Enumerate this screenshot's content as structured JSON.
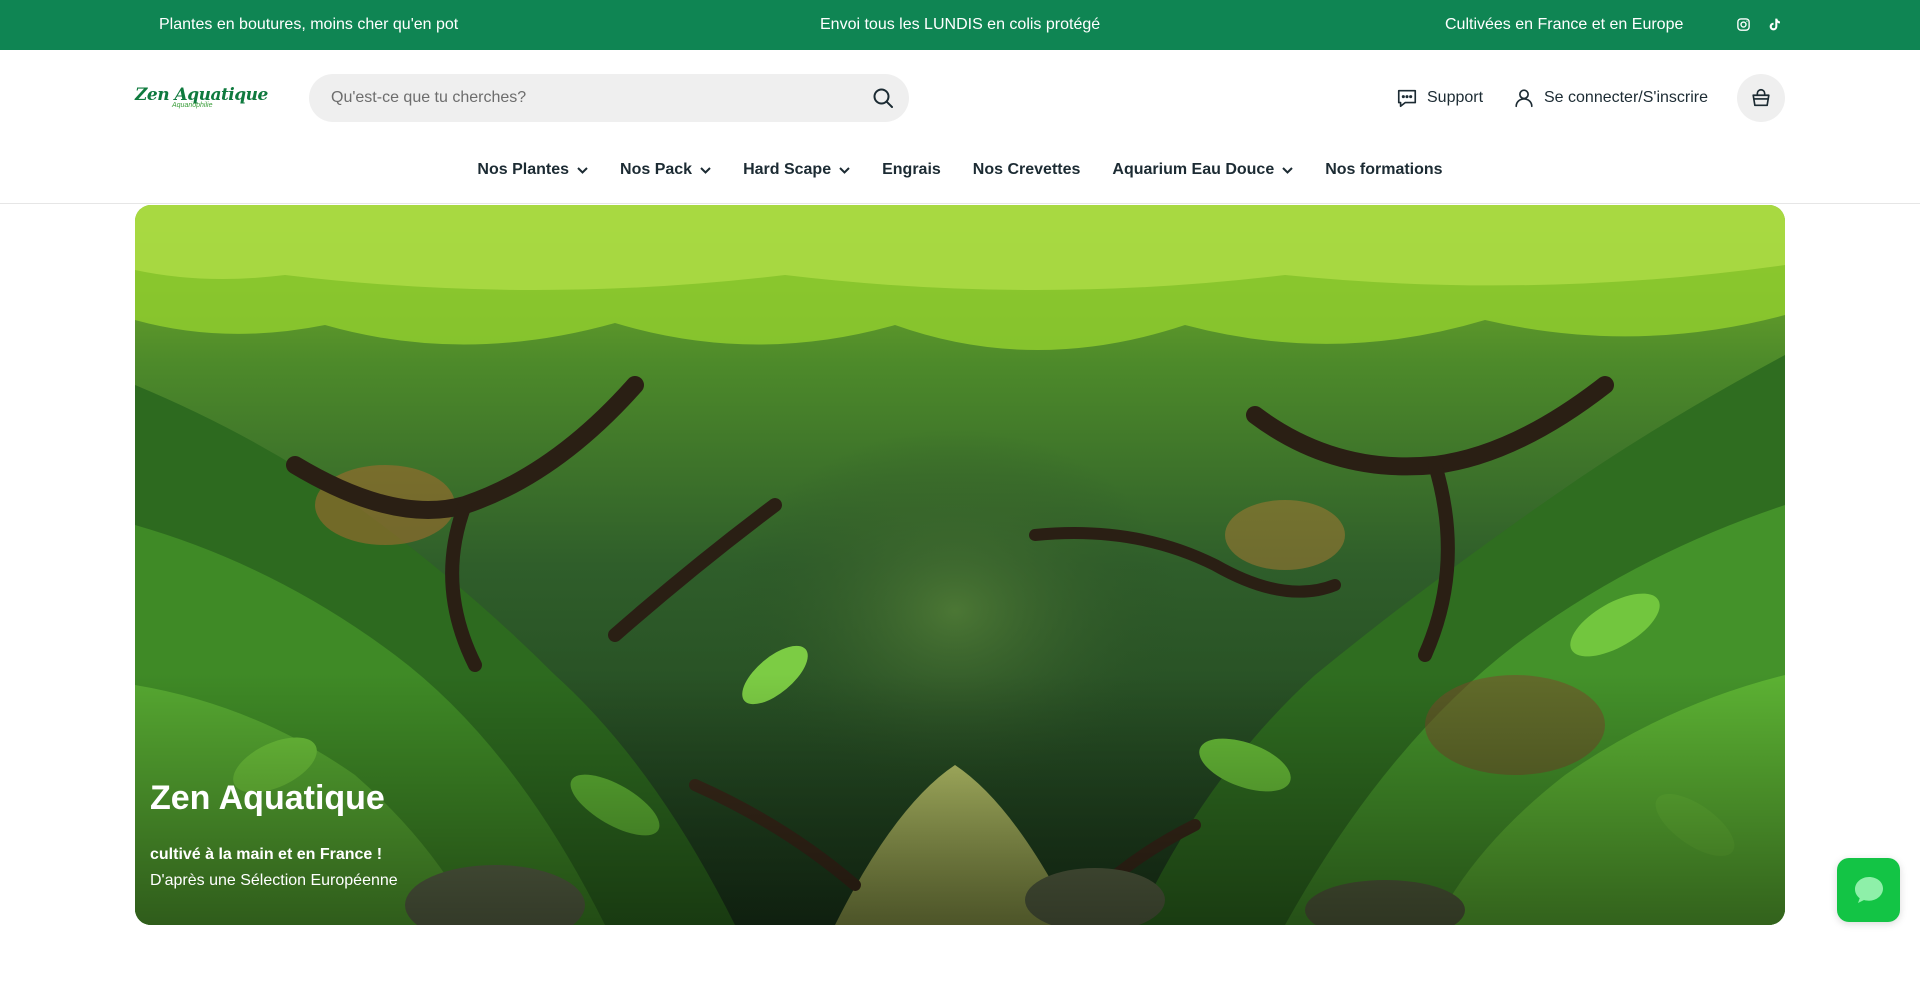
{
  "announcement": {
    "messages": [
      "Plantes en boutures, moins cher qu'en pot",
      "Envoi tous les LUNDIS en colis protégé",
      "Cultivées en France et en Europe"
    ],
    "social_icons": [
      "instagram-icon",
      "tiktok-icon"
    ],
    "background": "#0f8553"
  },
  "header": {
    "logo_text": "Zen Aquatique",
    "logo_sub": "Aquariophilie",
    "search_placeholder": "Qu'est-ce que tu cherches?",
    "support_label": "Support",
    "account_label": "Se connecter/S'inscrire"
  },
  "nav": {
    "items": [
      {
        "label": "Nos Plantes",
        "dropdown": true
      },
      {
        "label": "Nos Pack",
        "dropdown": true
      },
      {
        "label": "Hard Scape",
        "dropdown": true
      },
      {
        "label": "Engrais",
        "dropdown": false
      },
      {
        "label": "Nos Crevettes",
        "dropdown": false
      },
      {
        "label": "Aquarium Eau Douce",
        "dropdown": true
      },
      {
        "label": "Nos formations",
        "dropdown": false
      }
    ]
  },
  "hero": {
    "title": "Zen Aquatique",
    "tagline_bold": "cultivé à la main et en France !",
    "tagline": "D'après une Sélection Européenne"
  },
  "chat": {
    "icon": "chat-bubble-icon",
    "color": "#13c445"
  }
}
